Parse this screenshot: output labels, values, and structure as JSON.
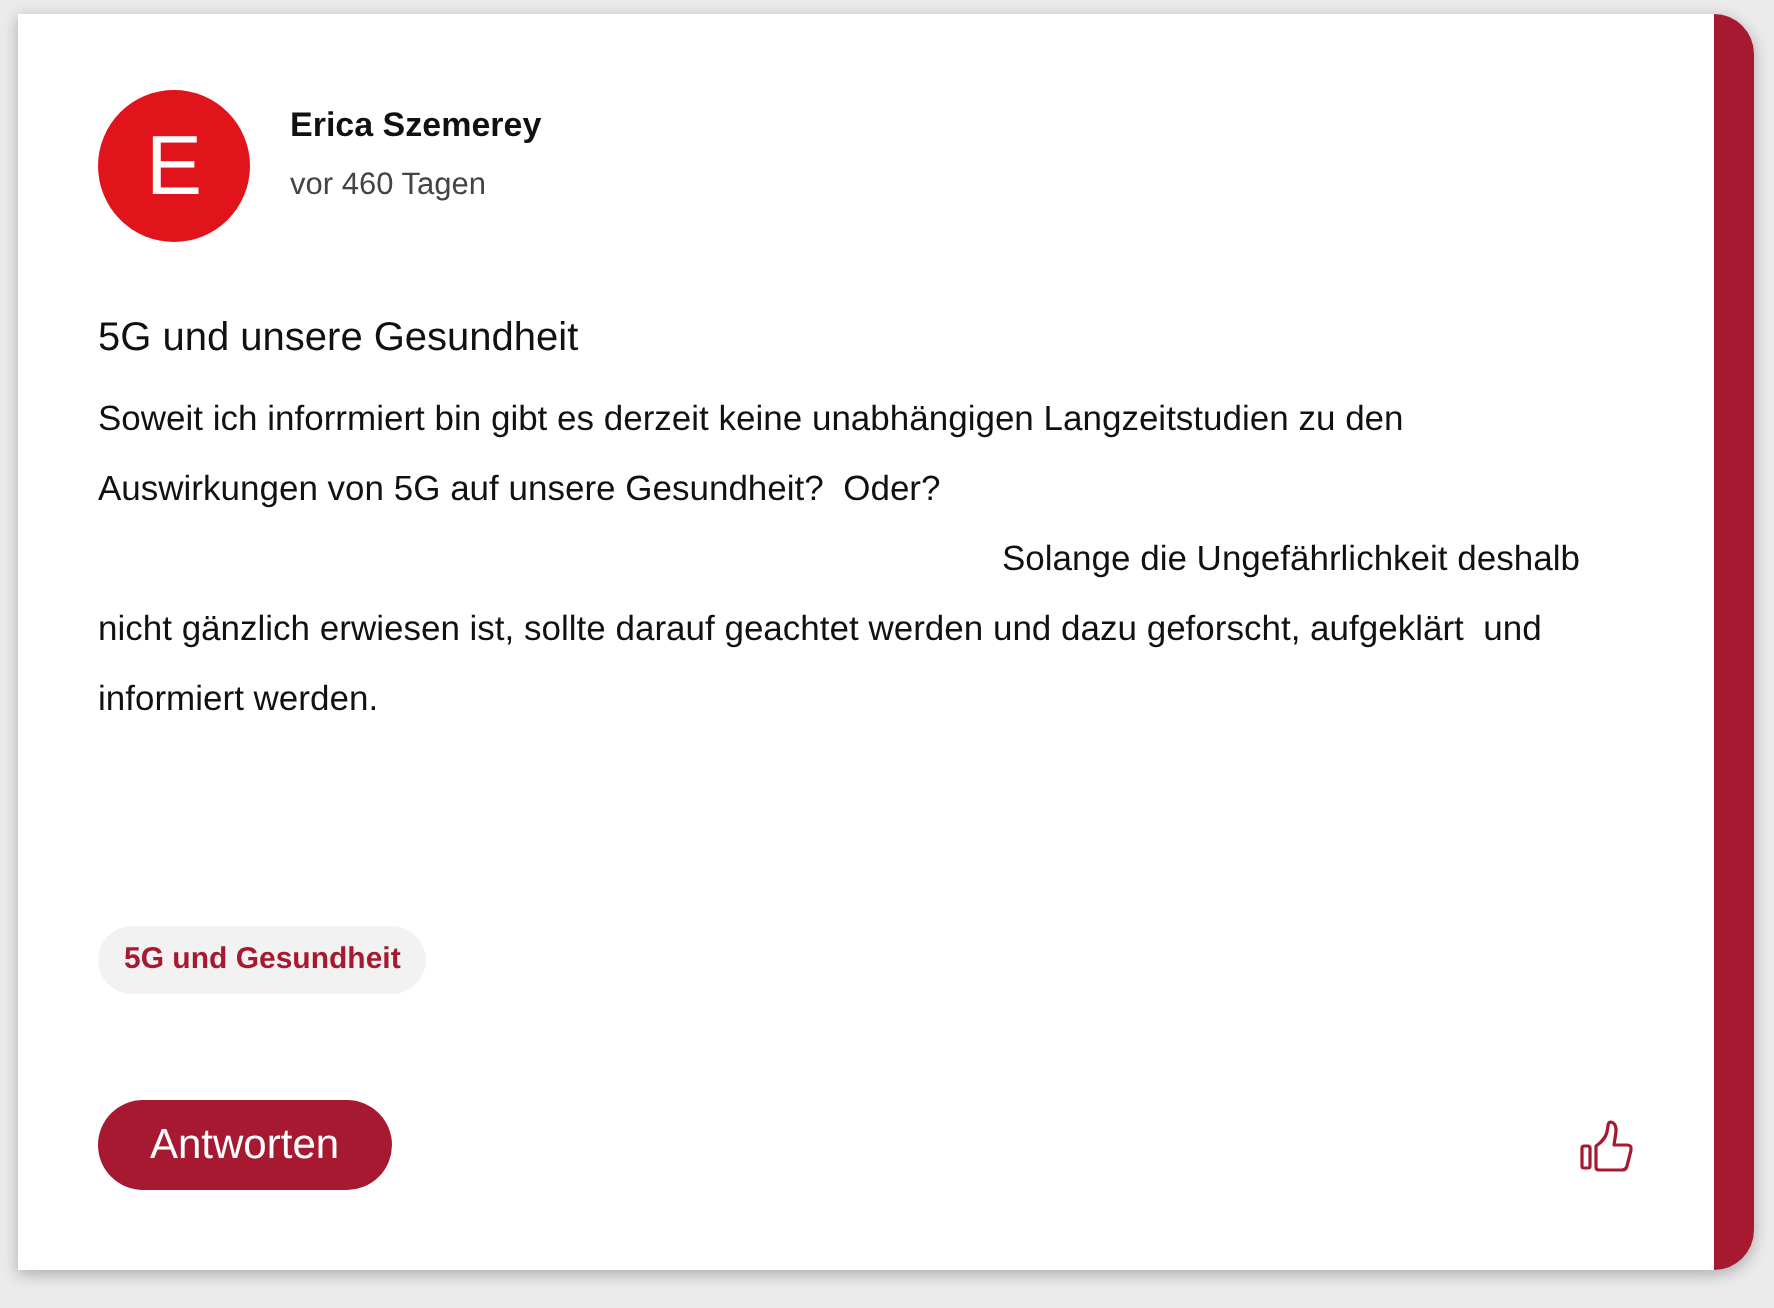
{
  "post": {
    "author": {
      "initial": "E",
      "name": "Erica Szemerey",
      "time": "vor 460 Tagen"
    },
    "title": "5G und unsere Gesundheit",
    "body_lines": [
      {
        "text": "Soweit ich inforrmiert bin gibt es derzeit keine unabhängigen Langzeitstudien zu den",
        "indented": false
      },
      {
        "text": "Auswirkungen von 5G auf unsere Gesundheit?  Oder?",
        "indented": false
      },
      {
        "text": "Solange die Ungefährlichkeit deshalb",
        "indented": true
      },
      {
        "text": "nicht gänzlich erwiesen ist, sollte darauf geachtet werden und dazu geforscht, aufgeklärt  und",
        "indented": false
      },
      {
        "text": "informiert werden.",
        "indented": false
      }
    ],
    "tags": [
      "5G und Gesundheit"
    ],
    "reply_button": "Antworten"
  }
}
